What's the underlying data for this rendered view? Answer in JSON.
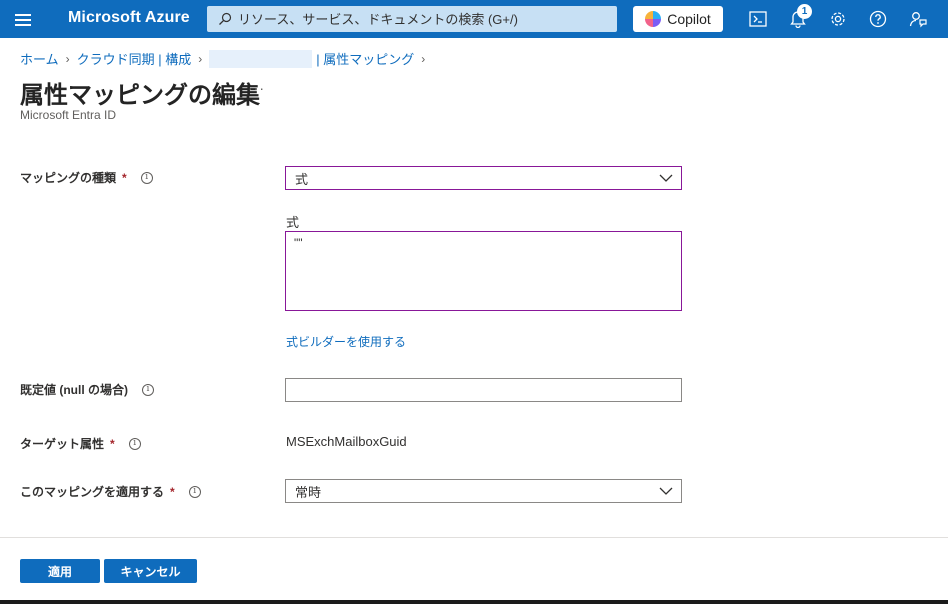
{
  "topbar": {
    "brand": "Microsoft Azure",
    "search_placeholder": "リソース、サービス、ドキュメントの検索 (G+/)",
    "copilot_label": "Copilot",
    "notification_count": "1",
    "icons": [
      "menu-icon",
      "search-icon",
      "cloud-shell-icon",
      "bell-icon",
      "gear-icon",
      "help-icon",
      "feedback-icon"
    ]
  },
  "breadcrumb": {
    "home": "ホーム",
    "cloud_sync": "クラウド同期 | 構成",
    "attr_mapping": "| 属性マッピング"
  },
  "page": {
    "title": "属性マッピングの編集",
    "more": "···",
    "subtitle": "Microsoft Entra ID"
  },
  "form": {
    "mapping_type_label": "マッピングの種類",
    "mapping_type_value": "式",
    "expression_label": "式",
    "expression_value": "\"\"",
    "expression_builder_link": "式ビルダーを使用する",
    "default_label": "既定値 (null の場合)",
    "default_value": "",
    "target_label": "ターゲット属性",
    "target_value": "MSExchMailboxGuid",
    "apply_label": "このマッピングを適用する",
    "apply_value": "常時",
    "required_mark": "*"
  },
  "footer": {
    "apply_button": "適用",
    "cancel_button": "キャンセル"
  },
  "colors": {
    "topbar": "#0f6cbd",
    "accent": "#0f6cbd",
    "focus_border": "#881798",
    "required": "#a4262c"
  }
}
